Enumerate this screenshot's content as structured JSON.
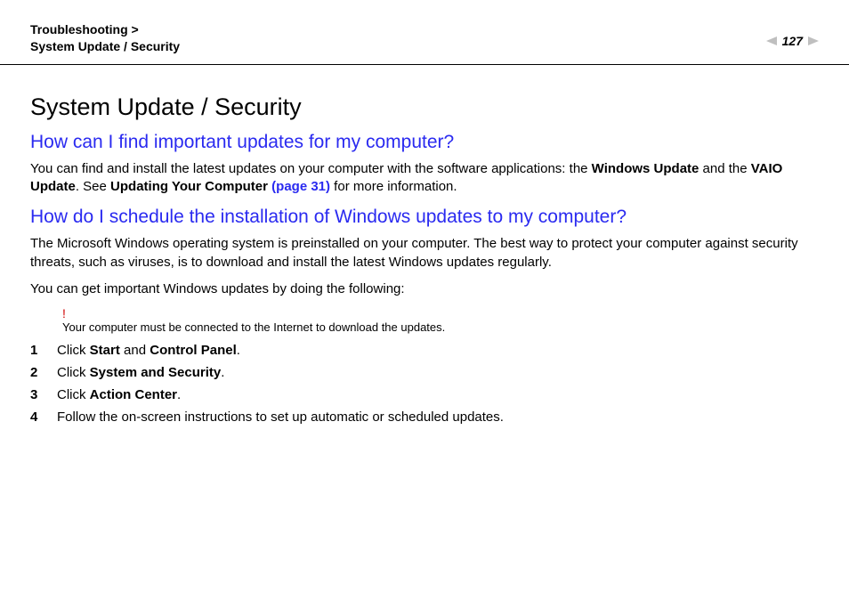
{
  "header": {
    "breadcrumb_line1": "Troubleshooting >",
    "breadcrumb_line2": "System Update / Security",
    "page_number": "127"
  },
  "title": "System Update / Security",
  "q1": {
    "heading": "How can I find important updates for my computer?",
    "para_pre": "You can find and install the latest updates on your computer with the software applications: the ",
    "bold1": "Windows Update",
    "mid1": " and the ",
    "bold2": "VAIO Update",
    "mid2": ". See ",
    "bold3": "Updating Your Computer ",
    "link": "(page 31)",
    "post": " for more information."
  },
  "q2": {
    "heading": "How do I schedule the installation of Windows updates to my computer?",
    "para1": "The Microsoft Windows operating system is preinstalled on your computer. The best way to protect your computer against security threats, such as viruses, is to download and install the latest Windows updates regularly.",
    "para2": "You can get important Windows updates by doing the following:",
    "note_bang": "!",
    "note_text": "Your computer must be connected to the Internet to download the updates.",
    "steps": [
      {
        "num": "1",
        "pre": "Click ",
        "b1": "Start",
        "mid": " and ",
        "b2": "Control Panel",
        "post": "."
      },
      {
        "num": "2",
        "pre": "Click ",
        "b1": "System and Security",
        "mid": "",
        "b2": "",
        "post": "."
      },
      {
        "num": "3",
        "pre": "Click ",
        "b1": "Action Center",
        "mid": "",
        "b2": "",
        "post": "."
      },
      {
        "num": "4",
        "pre": "Follow the on-screen instructions to set up automatic or scheduled updates.",
        "b1": "",
        "mid": "",
        "b2": "",
        "post": ""
      }
    ]
  }
}
